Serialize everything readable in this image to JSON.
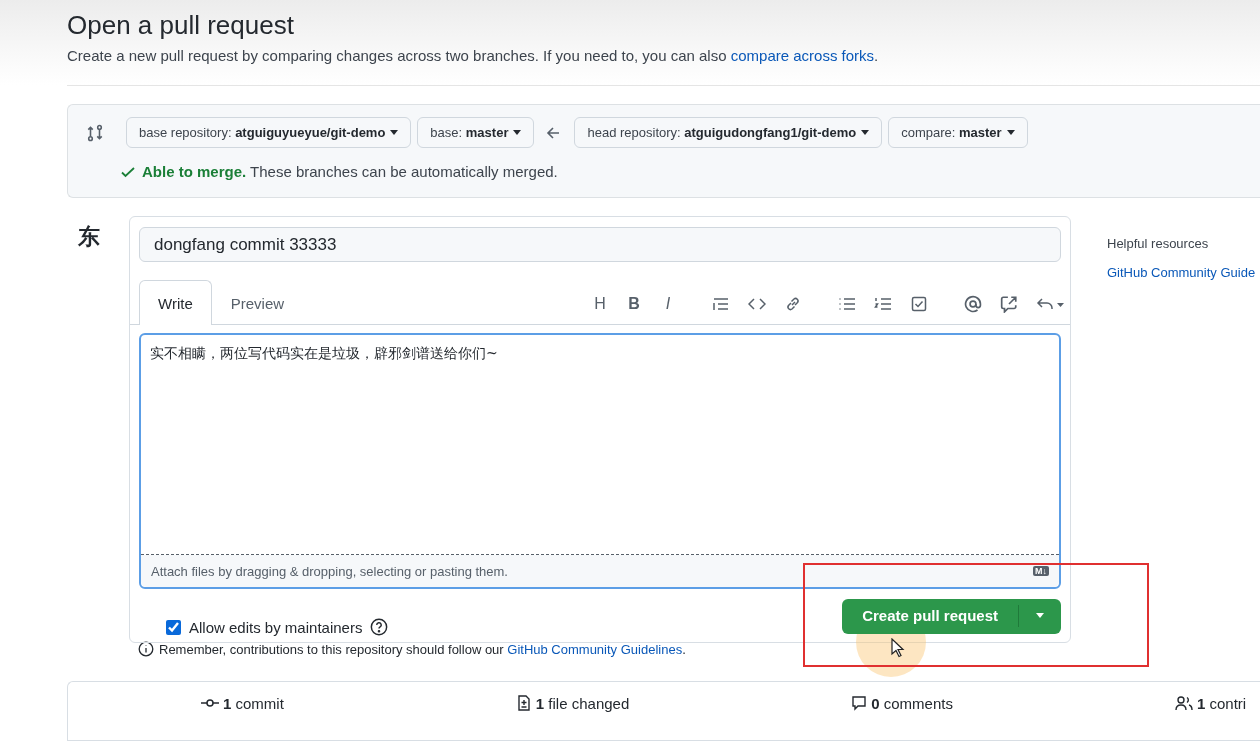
{
  "header": {
    "title": "Open a pull request",
    "subtitle": "Create a new pull request by comparing changes across two branches. If you need to, you can also ",
    "subtitle_link": "compare across forks",
    "subtitle_end": "."
  },
  "compare": {
    "selectors": [
      {
        "label": "base repository:",
        "value": "atguiguyueyue/git-demo"
      },
      {
        "label": "base:",
        "value": "master"
      },
      {
        "label": "head repository:",
        "value": "atguigudongfang1/git-demo"
      },
      {
        "label": "compare:",
        "value": "master"
      }
    ],
    "status_bold": "Able to merge.",
    "status_text": "These branches can be automatically merged."
  },
  "avatar": "东",
  "form": {
    "title_value": "dongfang commit 33333",
    "tabs": [
      {
        "label": "Write",
        "selected": true
      },
      {
        "label": "Preview",
        "selected": false
      }
    ],
    "toolbar_groups": [
      [
        {
          "kind": "heading",
          "label": "H"
        },
        {
          "kind": "bold",
          "label": "B"
        },
        {
          "kind": "italic",
          "label": "I"
        }
      ],
      [
        {
          "kind": "quote"
        },
        {
          "kind": "code"
        },
        {
          "kind": "link"
        }
      ],
      [
        {
          "kind": "bullets"
        },
        {
          "kind": "numbers"
        },
        {
          "kind": "task"
        }
      ],
      [
        {
          "kind": "mention"
        },
        {
          "kind": "reference"
        },
        {
          "kind": "reply"
        }
      ]
    ],
    "body": "实不相瞒，两位写代码实在是垃圾，辟邪剑谱送给你们~",
    "attach_hint": "Attach files by dragging & dropping, selecting or pasting them.",
    "markdown_badge": "M↓",
    "allow_edits": {
      "label": "Allow edits by maintainers",
      "checked": true
    },
    "submit": "Create pull request"
  },
  "remember": {
    "text": "Remember, contributions to this repository should follow our ",
    "link": "GitHub Community Guidelines",
    "end": "."
  },
  "sidebar": {
    "heading": "Helpful resources",
    "link": "GitHub Community Guide"
  },
  "stats": [
    {
      "kind": "commit",
      "count": "1",
      "label": "commit"
    },
    {
      "kind": "file",
      "count": "1",
      "label": "file changed"
    },
    {
      "kind": "comment",
      "count": "0",
      "label": "comments"
    },
    {
      "kind": "people",
      "count": "1",
      "label": "contri"
    }
  ]
}
